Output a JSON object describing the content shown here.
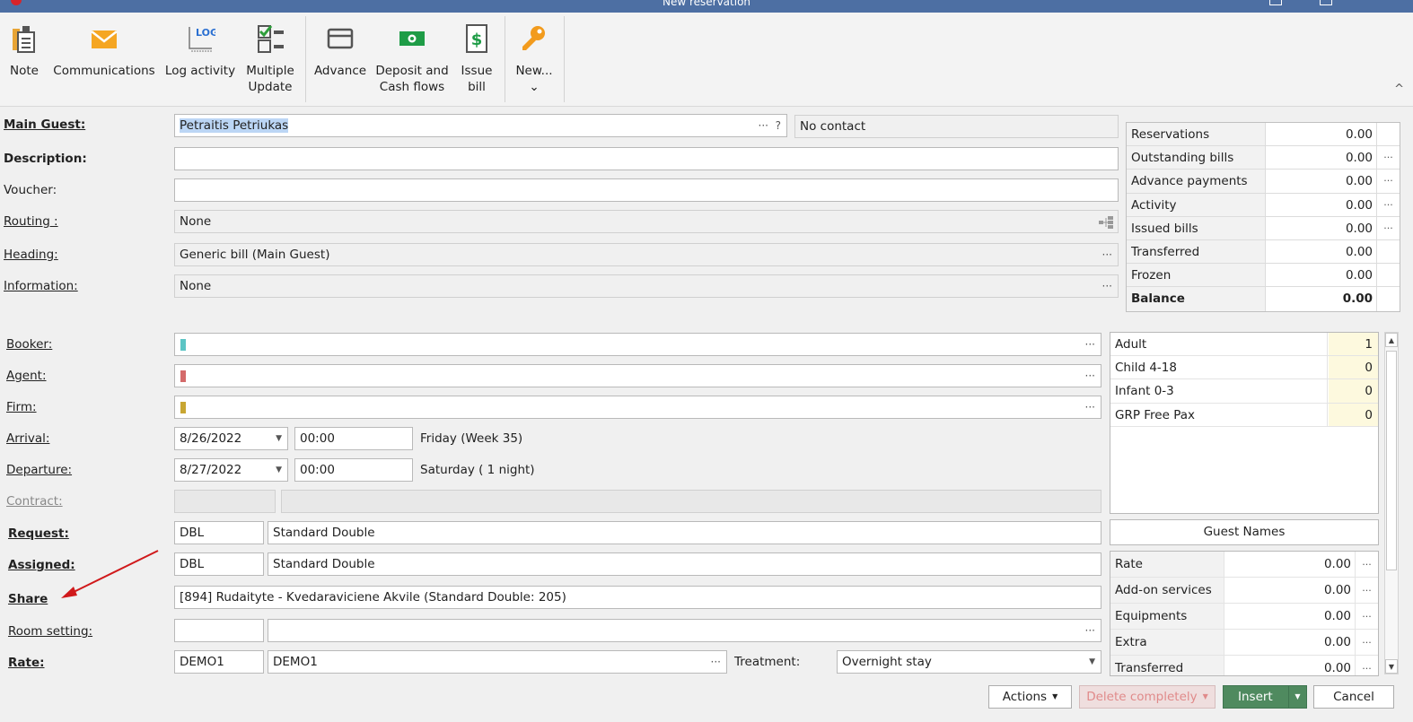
{
  "window": {
    "title": "New reservation"
  },
  "ribbon": {
    "note": "Note",
    "communications": "Communications",
    "log_activity": "Log activity",
    "log_badge": "LOG",
    "multiple_update": "Multiple\nUpdate",
    "advance": "Advance",
    "deposit": "Deposit and\nCash flows",
    "issue_bill": "Issue\nbill",
    "new": "New...",
    "new_caret": "⌄",
    "collapse": "^"
  },
  "form": {
    "main_guest": {
      "label": "Main Guest:",
      "value": "Petraitis Petriukas",
      "help": "?",
      "contact": "No contact"
    },
    "description": {
      "label": "Description:",
      "value": ""
    },
    "voucher": {
      "label": "Voucher:",
      "value": ""
    },
    "routing": {
      "label": "Routing :",
      "value": "None"
    },
    "heading": {
      "label": "Heading:",
      "value": "Generic bill (Main Guest)"
    },
    "information": {
      "label": "Information:",
      "value": "None"
    },
    "booker": {
      "label": "Booker:",
      "value": ""
    },
    "agent": {
      "label": "Agent:",
      "value": ""
    },
    "firm": {
      "label": "Firm:",
      "value": ""
    },
    "arrival": {
      "label": "Arrival:",
      "date": "8/26/2022",
      "time": "00:00",
      "info": "Friday (Week 35)"
    },
    "departure": {
      "label": "Departure:",
      "date": "8/27/2022",
      "time": "00:00",
      "info": "Saturday ( 1 night)"
    },
    "contract": {
      "label": "Contract:",
      "code": "",
      "value": ""
    },
    "request": {
      "label": "Request:",
      "code": "DBL",
      "value": "Standard Double"
    },
    "assigned": {
      "label": "Assigned:",
      "code": "DBL",
      "value": "Standard Double"
    },
    "share": {
      "label": "Share",
      "value": "[894] Rudaityte - Kvedaraviciene Akvile (Standard Double: 205)"
    },
    "room_setting": {
      "label": "Room setting:",
      "code": "",
      "value": ""
    },
    "rate": {
      "label": "Rate:",
      "code": "DEMO1",
      "value": "DEMO1",
      "treatment_label": "Treatment:",
      "treatment": "Overnight stay"
    }
  },
  "summary": [
    {
      "label": "Reservations",
      "value": "0.00",
      "more": ""
    },
    {
      "label": "Outstanding bills",
      "value": "0.00",
      "more": "···"
    },
    {
      "label": "Advance payments",
      "value": "0.00",
      "more": "···"
    },
    {
      "label": "Activity",
      "value": "0.00",
      "more": "···"
    },
    {
      "label": "Issued bills",
      "value": "0.00",
      "more": "···"
    },
    {
      "label": "Transferred",
      "value": "0.00",
      "more": ""
    },
    {
      "label": "Frozen",
      "value": "0.00",
      "more": ""
    },
    {
      "label": "Balance",
      "value": "0.00",
      "more": ""
    }
  ],
  "pax": [
    {
      "label": "Adult",
      "value": "1"
    },
    {
      "label": "Child 4-18",
      "value": "0"
    },
    {
      "label": "Infant 0-3",
      "value": "0"
    },
    {
      "label": "GRP Free Pax",
      "value": "0"
    }
  ],
  "guest_names": "Guest Names",
  "rates": [
    {
      "label": "Rate",
      "value": "0.00"
    },
    {
      "label": "Add-on services",
      "value": "0.00"
    },
    {
      "label": "Equipments",
      "value": "0.00"
    },
    {
      "label": "Extra",
      "value": "0.00"
    },
    {
      "label": "Transferred",
      "value": "0.00"
    }
  ],
  "dots": "···",
  "buttons": {
    "actions": "Actions",
    "delete": "Delete completely",
    "insert": "Insert",
    "cancel": "Cancel"
  },
  "colors": {
    "titlebar": "#4d6fa3",
    "insert": "#4f8a5f",
    "booker": "#5bc4c4",
    "agent": "#d46a6a",
    "firm": "#c8a632",
    "arrow": "#d0191b"
  }
}
